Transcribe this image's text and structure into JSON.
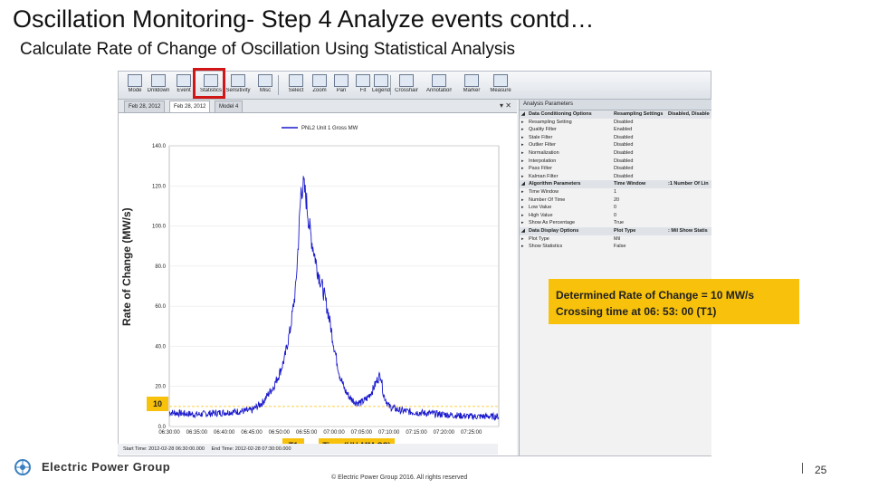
{
  "slide": {
    "title": "Oscillation Monitoring- Step 4 Analyze events contd…",
    "subtitle": "Calculate Rate of Change of Oscillation Using Statistical Analysis",
    "y_axis_label": "Rate of Change (MW/s)",
    "callout_line1": "Determined Rate of Change = 10 MW/s",
    "callout_line2": "Crossing time at 06: 53: 00 (T1)",
    "tag_threshold": "10",
    "tag_t1": "T1",
    "tag_xaxis": "Time (HH:MM:SS)",
    "footer": "© Electric Power Group 2016. All rights reserved",
    "page_number": "25",
    "logo_text": "Electric Power Group",
    "accent_color": "#f7c10c",
    "highlight_color": "#d01616"
  },
  "toolbar": {
    "items": [
      {
        "label": "Mode",
        "icon": "mode-icon"
      },
      {
        "label": "Drilldown",
        "icon": "drilldown-icon"
      },
      {
        "label": "Event",
        "icon": "event-icon"
      },
      {
        "label": "Statistics",
        "icon": "statistics-icon"
      },
      {
        "label": "Sensitivity",
        "icon": "sensitivity-icon"
      },
      {
        "label": "Misc",
        "icon": "misc-icon"
      },
      {
        "label": "Select",
        "icon": "select-icon"
      },
      {
        "label": "Zoom",
        "icon": "zoom-icon"
      },
      {
        "label": "Pan",
        "icon": "pan-icon"
      },
      {
        "label": "Fit",
        "icon": "fit-icon"
      },
      {
        "label": "Legend",
        "icon": "legend-icon"
      },
      {
        "label": "Crosshair",
        "icon": "crosshair-icon"
      },
      {
        "label": "Annotation",
        "icon": "annotation-icon"
      },
      {
        "label": "Marker",
        "icon": "marker-icon"
      },
      {
        "label": "Measure",
        "icon": "measure-icon"
      }
    ]
  },
  "tabs": [
    {
      "label": "Feb 28, 2012"
    },
    {
      "label": "Feb 28, 2012"
    },
    {
      "label": "Model 4"
    }
  ],
  "panel": {
    "title": "Analysis Parameters",
    "rows": [
      {
        "k": "Data Conditioning Options",
        "v": "Resampling Settings",
        "x": "Disabled, Disabled",
        "cat": true
      },
      {
        "k": "Resampling Setting",
        "v": "Disabled",
        "x": ""
      },
      {
        "k": "Quality Filter",
        "v": "Enabled",
        "x": ""
      },
      {
        "k": "Stale Filter",
        "v": "Disabled",
        "x": ""
      },
      {
        "k": "Outlier Filter",
        "v": "Disabled",
        "x": ""
      },
      {
        "k": "Normalization",
        "v": "Disabled",
        "x": ""
      },
      {
        "k": "Interpolation",
        "v": "Disabled",
        "x": ""
      },
      {
        "k": "Pass Filter",
        "v": "Disabled",
        "x": ""
      },
      {
        "k": "Kalman Filter",
        "v": "Disabled",
        "x": ""
      },
      {
        "k": "Algorithm Parameters",
        "v": "Time Window",
        "x": ":1 Number Of Lin",
        "cat": true
      },
      {
        "k": "Time Window",
        "v": "1",
        "x": ""
      },
      {
        "k": "Number Of Time",
        "v": "20",
        "x": ""
      },
      {
        "k": "Low Value",
        "v": "0",
        "x": ""
      },
      {
        "k": "High Value",
        "v": "0",
        "x": ""
      },
      {
        "k": "Show As Percentage",
        "v": "True",
        "x": ""
      },
      {
        "k": "Data Display Options",
        "v": "Plot Type",
        "x": ": Mil Show Statis",
        "cat": true
      },
      {
        "k": "Plot Type",
        "v": "Mil",
        "x": ""
      },
      {
        "k": "Show Statistics",
        "v": "False",
        "x": ""
      }
    ]
  },
  "status": {
    "start": "Start Time: 2012-02-28 06:30:00.000",
    "end": "End Time: 2012-02-28 07:30:00.000"
  },
  "chart_data": {
    "type": "line",
    "legend": "PNL2 Unit 1 Gross MW",
    "ylim": [
      0,
      140
    ],
    "yticks": [
      "140.0",
      "120.0",
      "100.0",
      "80.0",
      "60.0",
      "40.0",
      "20.0",
      "0.0"
    ],
    "xticks": [
      "06:30:00",
      "06:35:00",
      "06:40:00",
      "06:45:00",
      "06:50:00",
      "06:55:00",
      "07:00:00",
      "07:05:00",
      "07:10:00",
      "07:15:00",
      "07:20:00",
      "07:25:00"
    ],
    "threshold": 10,
    "series": [
      {
        "color": "#1a1acc",
        "x_minutes": [
          0,
          5,
          10,
          15,
          17,
          19,
          20,
          21,
          22,
          23,
          23.5,
          24,
          24.5,
          25,
          25.5,
          26,
          27,
          28,
          29,
          30,
          31,
          32,
          33,
          34,
          35,
          36,
          37,
          38,
          38.5,
          39,
          40,
          42,
          45,
          50,
          55,
          60
        ],
        "values": [
          7,
          6,
          7,
          8,
          12,
          20,
          26,
          34,
          48,
          68,
          92,
          118,
          120,
          112,
          100,
          92,
          78,
          68,
          56,
          40,
          26,
          18,
          14,
          12,
          12,
          14,
          18,
          24,
          26,
          16,
          10,
          8,
          7,
          6,
          5,
          5
        ]
      }
    ]
  }
}
